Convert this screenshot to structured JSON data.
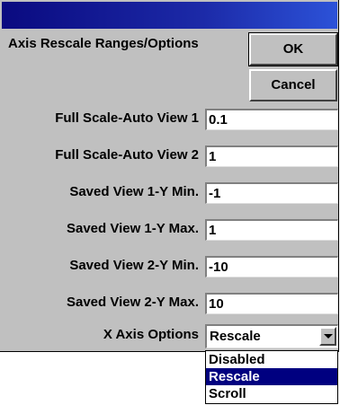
{
  "dialog": {
    "heading": "Axis Rescale Ranges/Options",
    "ok_label": "OK",
    "cancel_label": "Cancel"
  },
  "fields": [
    {
      "label": "Full Scale-Auto View 1",
      "value": "0.1"
    },
    {
      "label": "Full Scale-Auto View 2",
      "value": "1"
    },
    {
      "label": "Saved View 1-Y Min.",
      "value": "-1"
    },
    {
      "label": "Saved View 1-Y Max.",
      "value": "1"
    },
    {
      "label": "Saved View 2-Y Min.",
      "value": "-10"
    },
    {
      "label": "Saved View 2-Y Max.",
      "value": "10"
    }
  ],
  "x_axis": {
    "label": "X Axis Options",
    "selected": "Rescale",
    "options": [
      "Disabled",
      "Rescale",
      "Scroll"
    ]
  },
  "colors": {
    "face": "#c0c0c0",
    "title_start": "#0a0a80",
    "title_end": "#2c52d8",
    "selection": "#000080"
  }
}
